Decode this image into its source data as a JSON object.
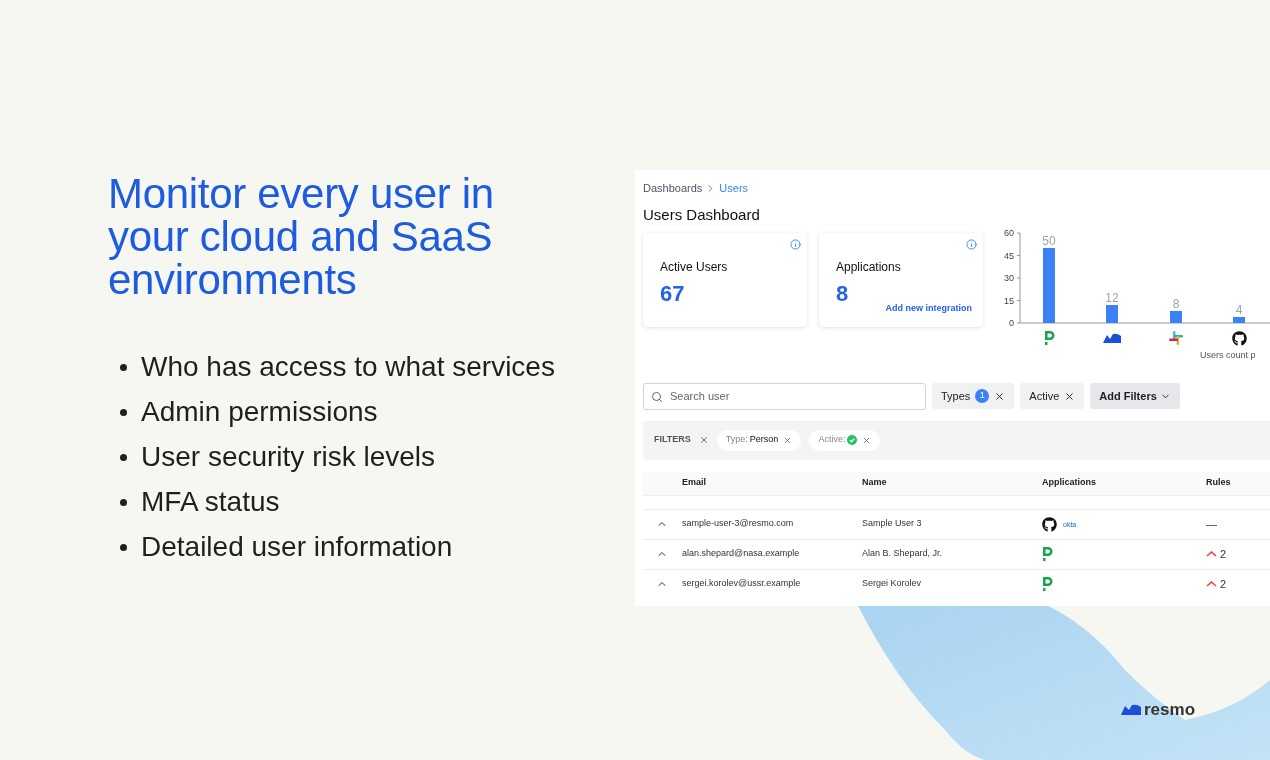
{
  "headline": "Monitor every user in your cloud and SaaS environments",
  "bullets": [
    "Who has access to what services",
    "Admin permissions",
    "User security risk levels",
    "MFA status",
    "Detailed user information"
  ],
  "dashboard": {
    "breadcrumb": [
      {
        "label": "Dashboards",
        "selected": false
      },
      {
        "label": "Users",
        "selected": true
      }
    ],
    "title": "Users Dashboard",
    "cards": [
      {
        "label": "Active Users",
        "value": "67"
      },
      {
        "label": "Applications",
        "value": "8",
        "link": "Add new integration"
      }
    ],
    "chart_data": {
      "type": "bar",
      "xlabel": "Users count p",
      "values": [
        50,
        12,
        8,
        4
      ],
      "ylim": [
        0,
        60
      ],
      "yticks": [
        0,
        15,
        30,
        45,
        60
      ],
      "data_labels": true
    },
    "search": {
      "placeholder": "Search user"
    },
    "filter_buttons": [
      {
        "label": "Types",
        "count": "1",
        "kind": "chip"
      },
      {
        "label": "Active",
        "kind": "chip"
      },
      {
        "label": "Add Filters",
        "kind": "dropdown"
      }
    ],
    "filters_bar": {
      "label": "FILTERS",
      "chips": [
        {
          "key": "Type:",
          "value": "Person",
          "kind": "text"
        },
        {
          "key": "Active:",
          "kind": "check"
        }
      ]
    },
    "table": {
      "columns": [
        "Email",
        "Name",
        "Applications",
        "Rules"
      ],
      "rows": [
        {
          "email": "sample-user-3@resmo.com",
          "name": "Sample User 3",
          "apps": [
            {
              "kind": "github"
            },
            {
              "kind": "okta",
              "text": "okta"
            }
          ],
          "rules": {
            "kind": "none",
            "text": "—"
          }
        },
        {
          "email": "alan.shepard@nasa.example",
          "name": "Alan B. Shepard, Jr.",
          "apps": [
            {
              "kind": "pagerduty"
            }
          ],
          "rules": {
            "kind": "risk",
            "text": "2"
          }
        },
        {
          "email": "sergei.korolev@ussr.example",
          "name": "Sergei Korolev",
          "apps": [
            {
              "kind": "pagerduty"
            }
          ],
          "rules": {
            "kind": "risk",
            "text": "2"
          }
        }
      ]
    }
  },
  "brand": "resmo"
}
